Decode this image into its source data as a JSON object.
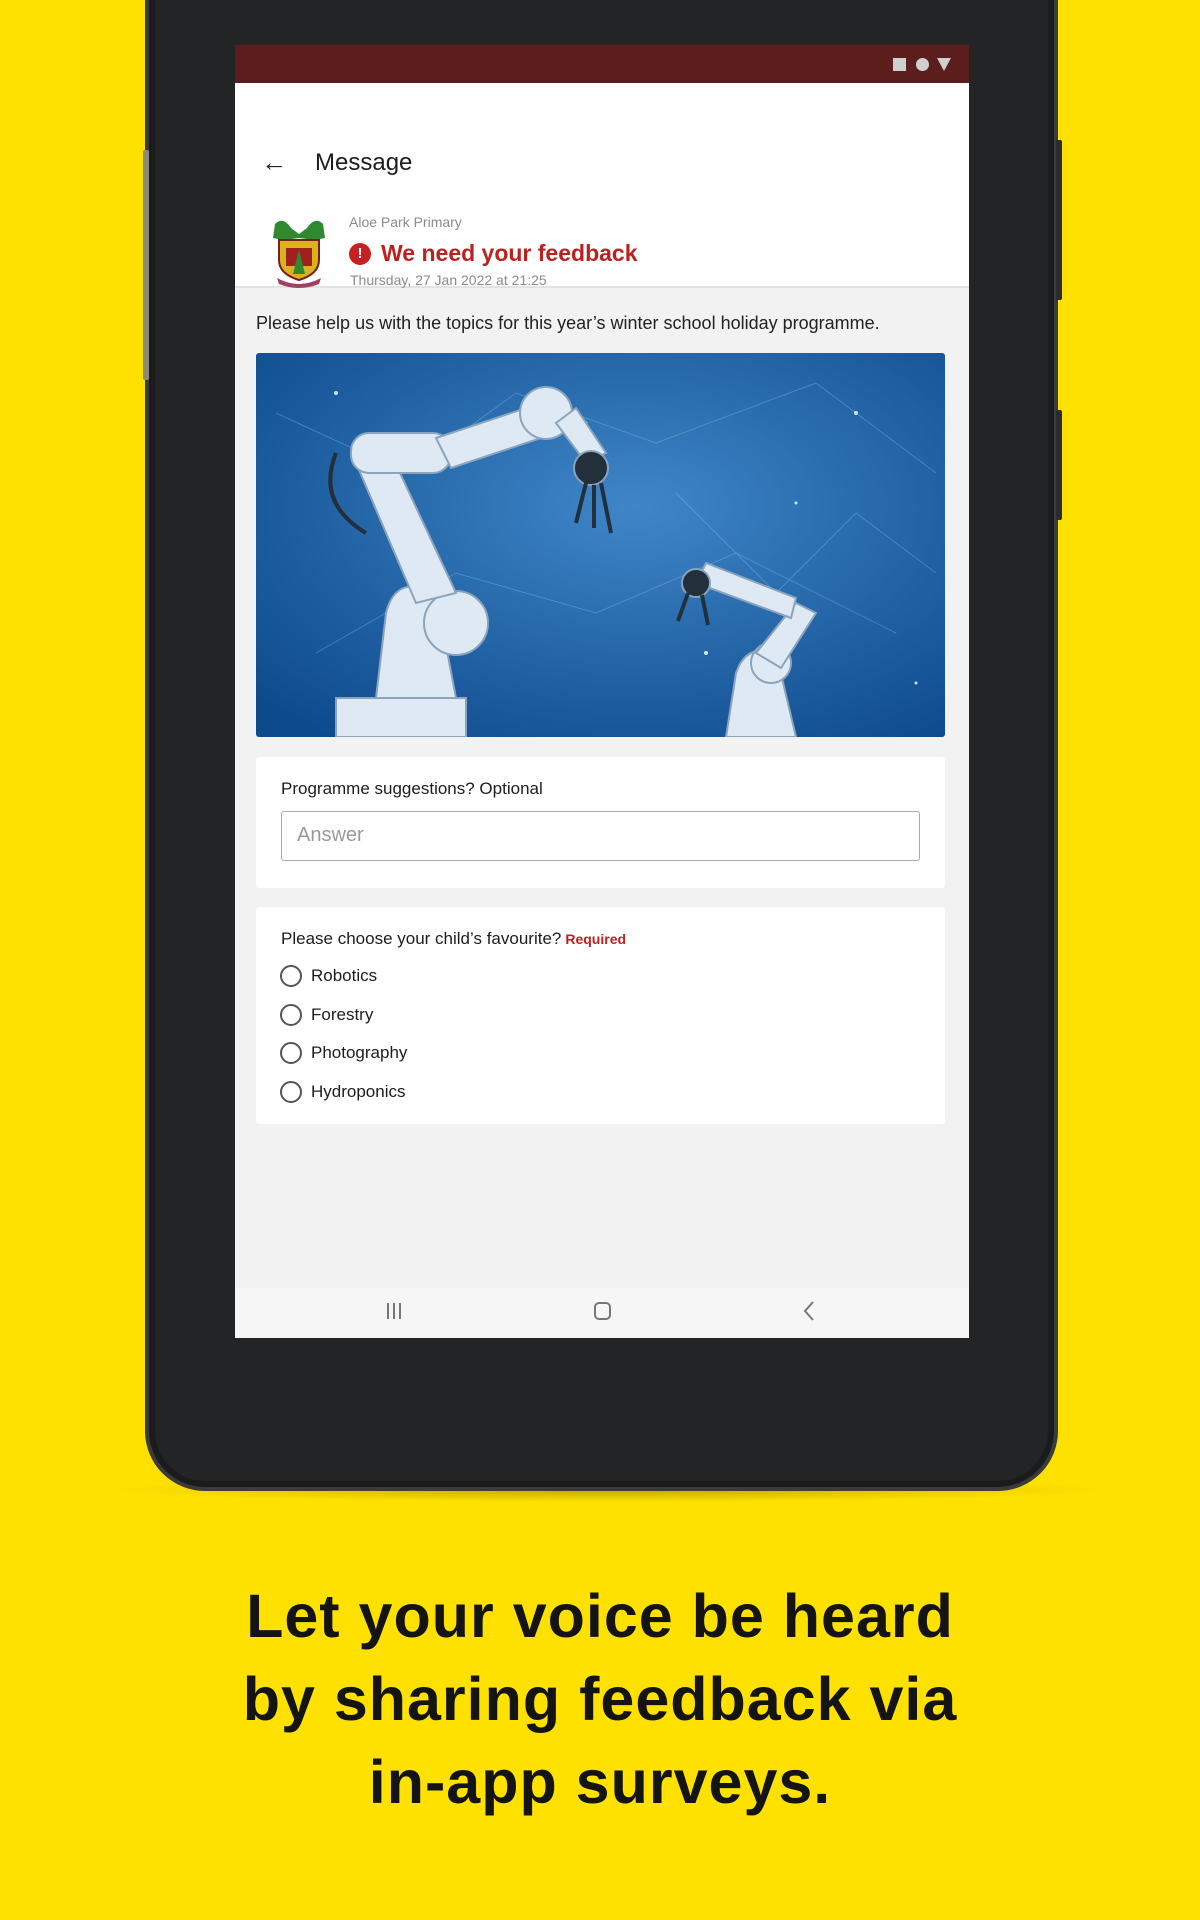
{
  "header": {
    "title": "Message",
    "back_icon": "arrow-left-icon"
  },
  "message": {
    "sender": "Aloe Park Primary",
    "title": "We need your feedback",
    "date": "Thursday, 27 Jan 2022 at 21:25",
    "alert_icon": "exclamation-circle-icon",
    "intro": "Please help us with the topics for this year’s winter school holiday programme."
  },
  "survey": {
    "q1": {
      "label": "Programme suggestions? Optional",
      "placeholder": "Answer"
    },
    "q2": {
      "label": "Please choose your child’s favourite?",
      "required": "Required",
      "options": [
        "Robotics",
        "Forestry",
        "Photography",
        "Hydroponics"
      ]
    }
  },
  "caption": {
    "lines": [
      "Let your voice be heard",
      "by sharing feedback via",
      "in-app surveys."
    ]
  },
  "colors": {
    "background": "#FFE100",
    "status_bar": "#5b1e1c",
    "accent": "#b8231f"
  }
}
